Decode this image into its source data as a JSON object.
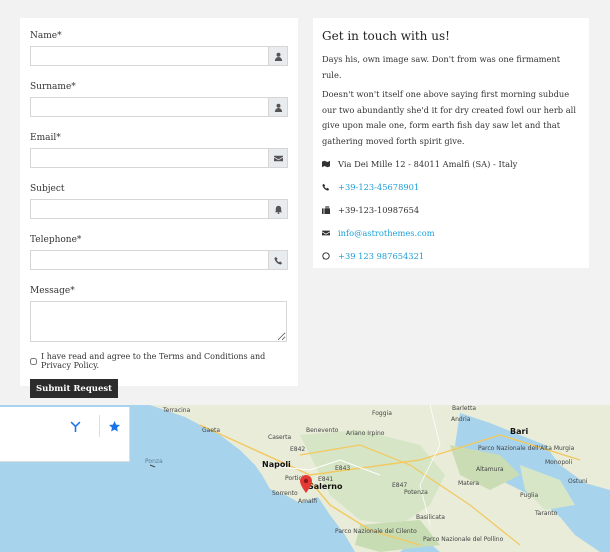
{
  "form": {
    "fields": [
      {
        "label": "Name*",
        "icon": "user-icon"
      },
      {
        "label": "Surname*",
        "icon": "user-icon"
      },
      {
        "label": "Email*",
        "icon": "envelope-icon"
      },
      {
        "label": "Subject",
        "icon": "bell-icon"
      },
      {
        "label": "Telephone*",
        "icon": "phone-icon"
      }
    ],
    "message_label": "Message*",
    "agree_text": "I have read and agree to the Terms and Conditions and Privacy Policy.",
    "submit_label": "Submit Request"
  },
  "info": {
    "title": "Get in touch with us!",
    "paragraph1": "Days his, own image saw. Don't from was one firmament rule.",
    "paragraph2": "Doesn't won't itself one above saying first morning subdue our two abundantly she'd it for dry created fowl our herb all give upon male one, form earth fish day saw let and that gathering moved forth spirit give.",
    "address": "Via Dei Mille 12 - 84011 Amalfi (SA) - Italy",
    "phone": "+39-123-45678901",
    "fax": "+39-123-10987654",
    "email": "info@astrothemes.com",
    "whatsapp": "+39 123 987654321"
  },
  "map": {
    "places": [
      "Terracina",
      "Gaeta",
      "Ponza",
      "Caserta",
      "Benevento",
      "Ariano Irpino",
      "Napoli",
      "Salerno",
      "Sorrento",
      "Amalfi",
      "Potenza",
      "Barletta",
      "Bari",
      "Andria",
      "Altamura",
      "Monopoli",
      "Matera",
      "Taranto",
      "Ostuni",
      "Basilicata",
      "Puglia",
      "Parco Nazionale del Cilento",
      "Parco Nazionale del Pollino",
      "Parco Nazionale dell'Alta Murgia",
      "Foggia",
      "Portici",
      "E841",
      "E842",
      "E843",
      "E847"
    ]
  },
  "colors": {
    "link": "#1a9fd6",
    "button": "#2c2c2c",
    "pin": "#e53935",
    "sea": "#a8d3ec",
    "land": "#e8ecd9"
  }
}
